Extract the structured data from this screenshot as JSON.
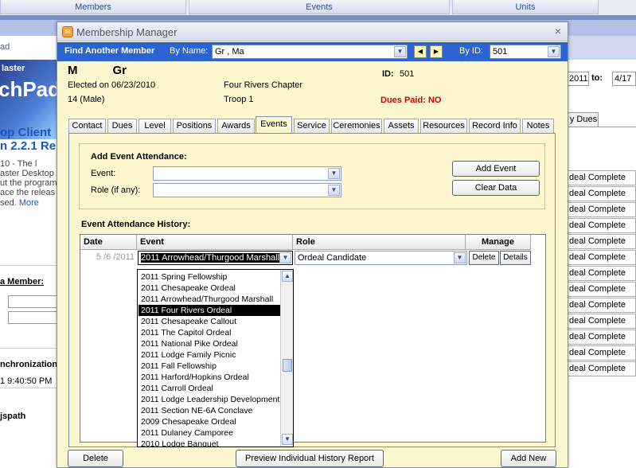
{
  "top_tabs": [
    "Members",
    "Events",
    "Units"
  ],
  "background_left": {
    "title_small": "ad",
    "logo_line1": "laster",
    "logo_line2": "chPad",
    "heading1": "op Client",
    "heading2": "n 2.2.1 Re",
    "paragraph": [
      "10 - The l",
      "aster Desktop c",
      "ut the program",
      "ace the releas",
      "sed."
    ],
    "more_link": "More",
    "find_member_label": "a Member:",
    "sync_label": "nchronization",
    "sync_time": "1 9:40:50 PM",
    "user": "jspath"
  },
  "background_right": {
    "date_from": "2011",
    "to_label": "to:",
    "date_to": "4/17",
    "tab_label": "y Dues",
    "rows": [
      "deal Complete",
      "deal Complete",
      "deal Complete",
      "deal Complete",
      "deal Complete",
      "deal Complete",
      "deal Complete",
      "deal Complete",
      "deal Complete",
      "deal Complete",
      "deal Complete",
      "deal Complete",
      "deal Complete"
    ]
  },
  "dialog": {
    "title": "Membership Manager",
    "close": "×",
    "find": {
      "label": "Find Another Member",
      "by_name_label": "By Name:",
      "by_name_value": "Gr    , Ma",
      "by_id_label": "By ID:",
      "by_id_value": "501"
    },
    "member": {
      "name_first": "M",
      "name_last": "Gr",
      "elected": "Elected on 06/23/2010",
      "age": "14 (Male)",
      "chapter": "Four Rivers Chapter",
      "troop": "Troop 1",
      "id_label": "ID:",
      "id_value": "501",
      "dues": "Dues Paid: NO"
    },
    "tabs": [
      "Contact",
      "Dues",
      "Level",
      "Positions",
      "Awards",
      "Events",
      "Service",
      "Ceremonies",
      "Assets",
      "Resources",
      "Record Info",
      "Notes"
    ],
    "active_tab": "Events",
    "add_event": {
      "title": "Add Event Attendance:",
      "event_label": "Event:",
      "role_label": "Role (if any):",
      "add_button": "Add Event",
      "clear_button": "Clear Data"
    },
    "history": {
      "title": "Event Attendance History:",
      "columns": [
        "Date",
        "Event",
        "Role",
        "Manage"
      ],
      "rows": [
        {
          "date": "5 /6 /2011",
          "event": "2011 Arrowhead/Thurgood Marshall",
          "role": "Ordeal Candidate",
          "delete": "Delete",
          "details": "Details"
        }
      ]
    },
    "dropdown_options": [
      "2011 Spring Fellowship",
      "2011 Chesapeake Ordeal",
      "2011 Arrowhead/Thurgood Marshall",
      "2011 Four Rivers Ordeal",
      "2011 Chesapeake Callout",
      "2011 The Capitol Ordeal",
      "2011 National Pike Ordeal",
      "2011 Lodge Family Picnic",
      "2011 Fall Fellowship",
      "2011 Harford/Hopkins Ordeal",
      "2011 Carroll Ordeal",
      "2011 Lodge Leadership Development",
      "2011 Section NE-6A Conclave",
      "2009 Chesapeake Ordeal",
      "2011 Dulaney Camporee",
      "2010 Lodge Banquet"
    ],
    "dropdown_selected": "2011 Four Rivers Ordeal",
    "footer": {
      "delete": "Delete",
      "preview": "Preview Individual History Report",
      "add_new": "Add New"
    }
  }
}
